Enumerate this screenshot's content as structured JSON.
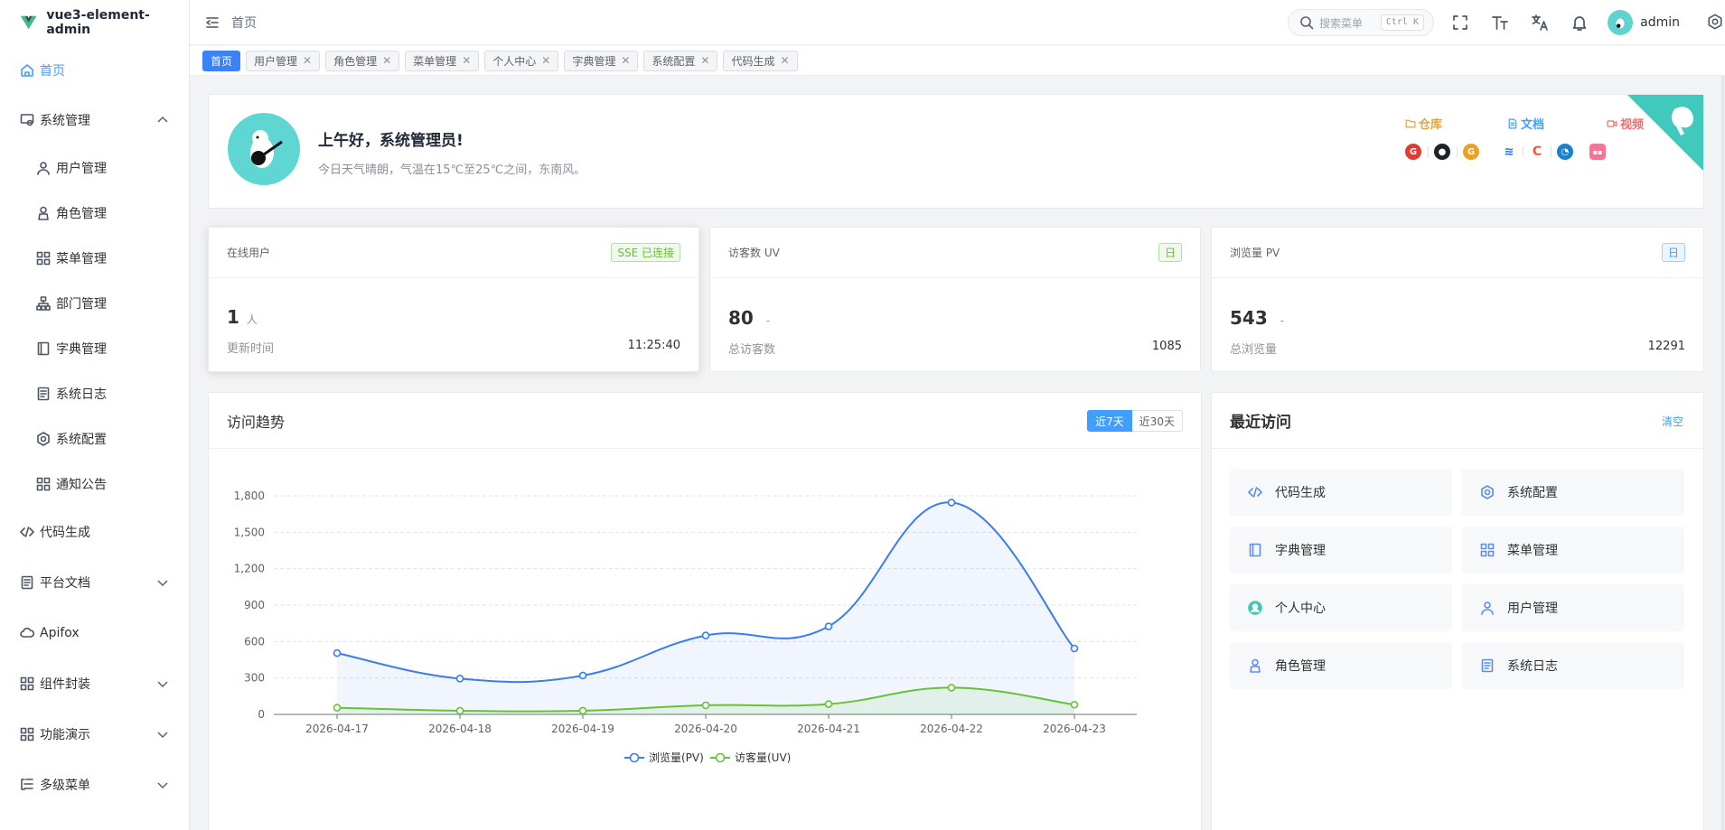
{
  "app": {
    "title": "vue3-element-admin"
  },
  "sidebar": {
    "items": [
      {
        "label": "首页",
        "icon": "home-icon"
      },
      {
        "label": "系统管理",
        "icon": "system-icon"
      },
      {
        "label": "用户管理",
        "icon": "user-icon"
      },
      {
        "label": "角色管理",
        "icon": "role-icon"
      },
      {
        "label": "菜单管理",
        "icon": "menu-icon"
      },
      {
        "label": "部门管理",
        "icon": "dept-icon"
      },
      {
        "label": "字典管理",
        "icon": "dict-icon"
      },
      {
        "label": "系统日志",
        "icon": "log-icon"
      },
      {
        "label": "系统配置",
        "icon": "config-icon"
      },
      {
        "label": "通知公告",
        "icon": "notice-icon"
      },
      {
        "label": "代码生成",
        "icon": "code-icon"
      },
      {
        "label": "平台文档",
        "icon": "doc-icon"
      },
      {
        "label": "Apifox",
        "icon": "cloud-icon"
      },
      {
        "label": "组件封装",
        "icon": "component-icon"
      },
      {
        "label": "功能演示",
        "icon": "demo-icon"
      },
      {
        "label": "多级菜单",
        "icon": "multilevel-icon"
      }
    ]
  },
  "header": {
    "breadcrumb": "首页",
    "search_placeholder": "搜索菜单",
    "search_shortcut": "Ctrl K",
    "username": "admin"
  },
  "tags": [
    {
      "label": "首页",
      "active": true
    },
    {
      "label": "用户管理"
    },
    {
      "label": "角色管理"
    },
    {
      "label": "菜单管理"
    },
    {
      "label": "个人中心"
    },
    {
      "label": "字典管理"
    },
    {
      "label": "系统配置"
    },
    {
      "label": "代码生成"
    }
  ],
  "welcome": {
    "greeting": "上午好，系统管理员!",
    "weather": "今日天气晴朗，气温在15℃至25℃之间，东南风。",
    "links": {
      "repo": "仓库",
      "docs": "文档",
      "video": "视频"
    }
  },
  "stats": {
    "online": {
      "title": "在线用户",
      "badge": "SSE 已连接",
      "value": "1",
      "unit": "人",
      "label": "更新时间",
      "detail": "11:25:40"
    },
    "uv": {
      "title": "访客数 UV",
      "badge": "日",
      "value": "80",
      "unit": "-",
      "label": "总访客数",
      "detail": "1085"
    },
    "pv": {
      "title": "浏览量 PV",
      "badge": "日",
      "value": "543",
      "unit": "-",
      "label": "总浏览量",
      "detail": "12291"
    }
  },
  "trend": {
    "title": "访问趋势",
    "range_7": "近7天",
    "range_30": "近30天"
  },
  "chart_data": {
    "type": "line",
    "x": [
      "2026-04-17",
      "2026-04-18",
      "2026-04-19",
      "2026-04-20",
      "2026-04-21",
      "2026-04-22",
      "2026-04-23"
    ],
    "series": [
      {
        "name": "浏览量(PV)",
        "values": [
          505,
          295,
          320,
          650,
          725,
          1745,
          543
        ],
        "color": "#3b7ded"
      },
      {
        "name": "访客量(UV)",
        "values": [
          55,
          30,
          30,
          75,
          85,
          220,
          80
        ],
        "color": "#67c23a"
      }
    ],
    "ylim": [
      0,
      1800
    ],
    "yticks": [
      "0",
      "300",
      "600",
      "900",
      "1,200",
      "1,500",
      "1,800"
    ],
    "grid": true,
    "legend": "bottom-center",
    "smooth": true,
    "area_fill": true
  },
  "recent": {
    "title": "最近访问",
    "clear": "清空",
    "items": [
      {
        "label": "代码生成",
        "icon": "code-icon"
      },
      {
        "label": "系统配置",
        "icon": "config-icon"
      },
      {
        "label": "字典管理",
        "icon": "dict-icon"
      },
      {
        "label": "菜单管理",
        "icon": "menu-icon"
      },
      {
        "label": "个人中心",
        "icon": "profile-icon"
      },
      {
        "label": "用户管理",
        "icon": "user-icon"
      },
      {
        "label": "角色管理",
        "icon": "role-icon"
      },
      {
        "label": "系统日志",
        "icon": "log-icon"
      }
    ]
  }
}
